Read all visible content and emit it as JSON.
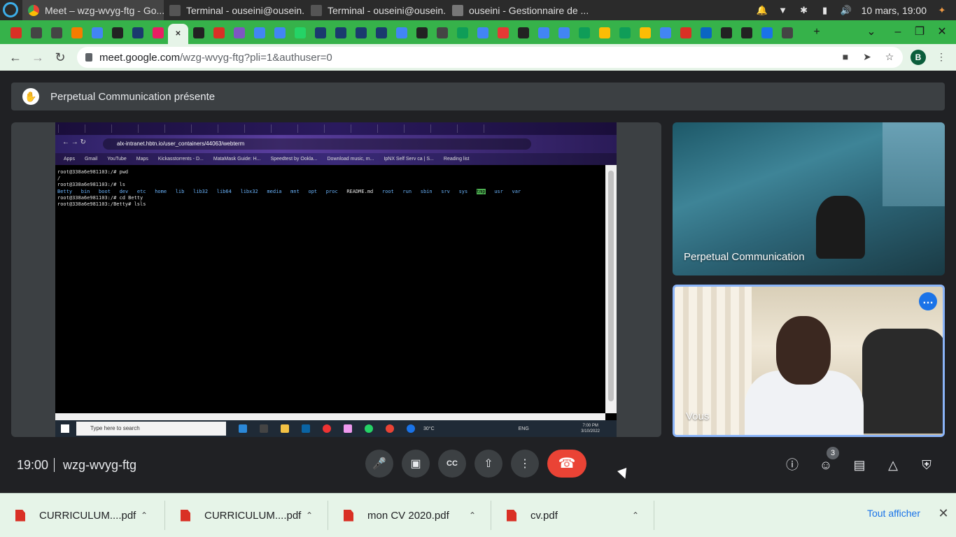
{
  "os_panel": {
    "tasks": [
      {
        "label": "Meet – wzg-wvyg-ftg - Go...",
        "active": true
      },
      {
        "label": "Terminal - ouseini@ousein...",
        "active": false
      },
      {
        "label": "Terminal - ouseini@ousein...",
        "active": false
      },
      {
        "label": "ouseini - Gestionnaire de ...",
        "active": false
      }
    ],
    "clock": "10 mars, 19:00",
    "tray_icons": [
      "bell-icon",
      "wifi-icon",
      "bluetooth-icon",
      "battery-icon",
      "volume-icon"
    ]
  },
  "browser": {
    "pinned_tab_count": 39,
    "active_tab_index": 8,
    "new_tab_label": "+",
    "url_host": "meet.google.com",
    "url_path": "/wzg-wvyg-ftg?pli=1&authuser=0",
    "profile_initial": "B"
  },
  "meet": {
    "presenting_label": "Perpetual Communication présente",
    "shared_screen": {
      "url": "alx-intranet.hbtn.io/user_containers/44063/webterm",
      "bookmarks": [
        "Apps",
        "Gmail",
        "YouTube",
        "Maps",
        "Kickasstorrents - D...",
        "MataMask Guide: H...",
        "Speedtest by Ookla...",
        "Download music, m...",
        "IpNX Self Serv ca | S...",
        "Reading list"
      ],
      "terminal_lines": [
        "root@338a6e981103:/# pwd",
        "/",
        "root@338a6e981103:/# ls"
      ],
      "ls_output": [
        "Betty",
        "bin",
        "boot",
        "dev",
        "etc",
        "home",
        "lib",
        "lib32",
        "lib64",
        "libx32",
        "media",
        "mnt",
        "opt",
        "proc",
        "README.md",
        "root",
        "run",
        "sbin",
        "srv",
        "sys",
        "tmp",
        "usr",
        "var"
      ],
      "terminal_tail": [
        "root@338a6e981103:/# cd Betty",
        "root@338a6e981103:/Betty# lsls"
      ],
      "taskbar_search": "Type here to search",
      "taskbar_temp": "30°C",
      "taskbar_lang": "ENG",
      "taskbar_time": "7:00 PM",
      "taskbar_date": "3/10/2022"
    },
    "participants": [
      {
        "name": "Perpetual Communication"
      },
      {
        "name": "Vous"
      }
    ],
    "meeting_time": "19:00",
    "meeting_code": "wzg-wvyg-ftg",
    "people_count": "3"
  },
  "downloads": {
    "items": [
      "CURRICULUM....pdf",
      "CURRICULUM....pdf",
      "mon CV 2020.pdf",
      "cv.pdf"
    ],
    "show_all": "Tout afficher"
  },
  "colors": {
    "tab_strip": "#36b24a",
    "toolbar": "#e6f4e8",
    "meet_bg": "#202124",
    "hangup": "#ea4335",
    "accent": "#1a73e8"
  }
}
